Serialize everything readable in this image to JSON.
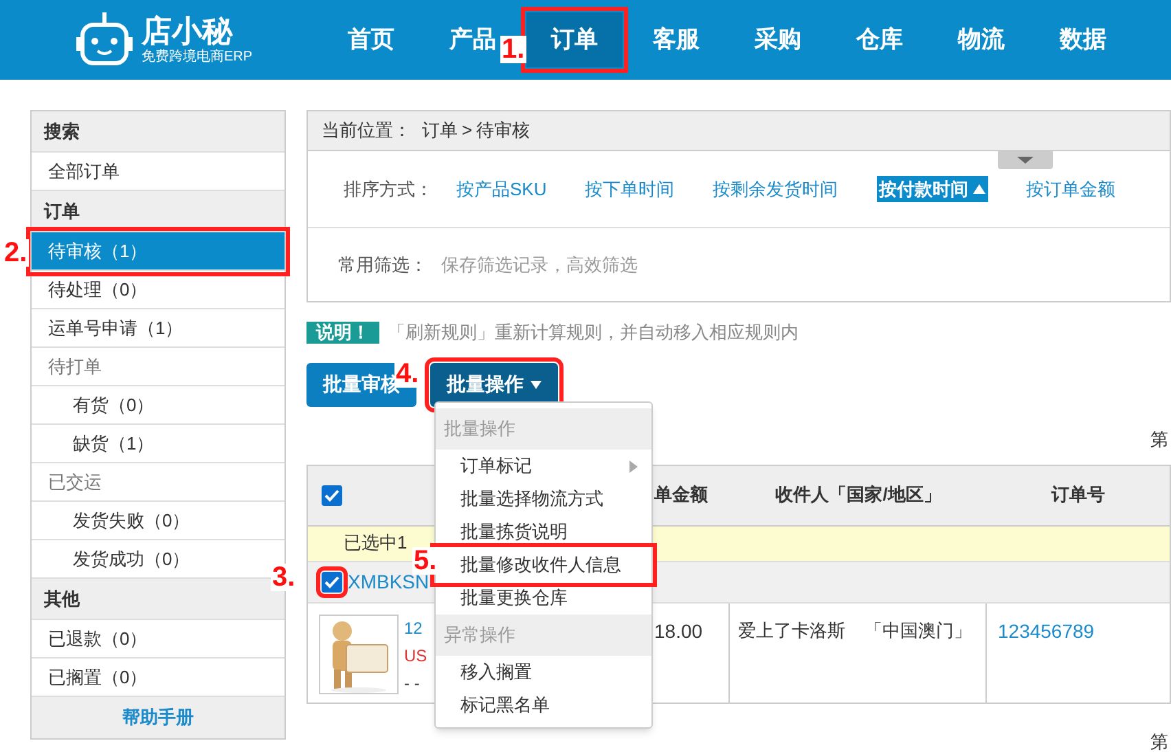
{
  "header": {
    "logo": {
      "name": "店小秘",
      "tagline": "免费跨境电商ERP"
    },
    "nav": [
      {
        "label": "首页",
        "selected": false
      },
      {
        "label": "产品",
        "selected": false
      },
      {
        "label": "订单",
        "selected": true
      },
      {
        "label": "客服",
        "selected": false
      },
      {
        "label": "采购",
        "selected": false
      },
      {
        "label": "仓库",
        "selected": false
      },
      {
        "label": "物流",
        "selected": false
      },
      {
        "label": "数据",
        "selected": false
      }
    ]
  },
  "sidebar": {
    "sections": [
      {
        "title": "搜索",
        "items": [
          {
            "label": "全部订单",
            "kind": "link",
            "selected": false
          }
        ]
      },
      {
        "title": "订单",
        "items": [
          {
            "label": "待审核",
            "count": "（1）",
            "kind": "link",
            "selected": true
          },
          {
            "label": "待处理",
            "count": "（0）",
            "kind": "link",
            "selected": false
          },
          {
            "label": "运单号申请",
            "count": "（1）",
            "kind": "link",
            "selected": false
          },
          {
            "label": "待打单",
            "kind": "group",
            "selected": false,
            "children": [
              {
                "label": "有货",
                "count": "（0）",
                "kind": "link",
                "selected": false
              },
              {
                "label": "缺货",
                "count": "（1）",
                "kind": "link",
                "selected": false
              }
            ]
          },
          {
            "label": "已交运",
            "kind": "group",
            "selected": false,
            "children": [
              {
                "label": "发货失败",
                "count": "（0）",
                "kind": "link",
                "selected": false
              },
              {
                "label": "发货成功",
                "count": "（0）",
                "kind": "link",
                "selected": false
              }
            ]
          }
        ]
      },
      {
        "title": "其他",
        "items": [
          {
            "label": "已退款",
            "count": "（0）",
            "kind": "link",
            "selected": false
          },
          {
            "label": "已搁置",
            "count": "（0）",
            "kind": "link",
            "selected": false
          }
        ]
      }
    ],
    "help": "帮助手册"
  },
  "breadcrumb": {
    "label": "当前位置：",
    "path": [
      "订单",
      "待审核"
    ],
    "separator": ">"
  },
  "sort": {
    "label": "排序方式：",
    "options": [
      {
        "label": "按产品SKU",
        "selected": false
      },
      {
        "label": "按下单时间",
        "selected": false
      },
      {
        "label": "按剩余发货时间",
        "selected": false
      },
      {
        "label": "按付款时间",
        "selected": true
      },
      {
        "label": "按订单金额",
        "selected": false
      }
    ]
  },
  "filter": {
    "label": "常用筛选：",
    "hint": "保存筛选记录，高效筛选"
  },
  "notice": {
    "badge": "说明！",
    "text": "「刷新规则」重新计算规则，并自动移入相应规则内"
  },
  "buttons": [
    {
      "label": "批量审核",
      "kind": "plain"
    },
    {
      "label": "批量操作",
      "kind": "dropdown"
    }
  ],
  "pager_labels": [
    "第",
    "第"
  ],
  "table": {
    "header_checked": true,
    "columns": [
      "单金额",
      "收件人「国家/地区」",
      "订单号"
    ],
    "selection_text": "已选中1",
    "orders": [
      {
        "checked": true,
        "order_id": "XMBKSN",
        "product_link": "12",
        "currency": "US",
        "dash": "- -",
        "amount": "18.00",
        "recipient": "爱上了卡洛斯",
        "country": "「中国澳门」",
        "order_no": "123456789"
      }
    ]
  },
  "menu": {
    "sections": [
      {
        "title": "批量操作",
        "items": [
          {
            "label": "订单标记",
            "submenu": true
          },
          {
            "label": "批量选择物流方式",
            "submenu": false
          },
          {
            "label": "批量拣货说明",
            "submenu": false
          },
          {
            "label": "批量修改收件人信息",
            "submenu": false
          },
          {
            "label": "批量更换仓库",
            "submenu": false
          }
        ]
      },
      {
        "title": "异常操作",
        "items": [
          {
            "label": "移入搁置",
            "submenu": false
          },
          {
            "label": "标记黑名单",
            "submenu": false
          }
        ]
      }
    ]
  },
  "annotations": [
    {
      "number": "1."
    },
    {
      "number": "2."
    },
    {
      "number": "3."
    },
    {
      "number": "4."
    },
    {
      "number": "5."
    }
  ]
}
